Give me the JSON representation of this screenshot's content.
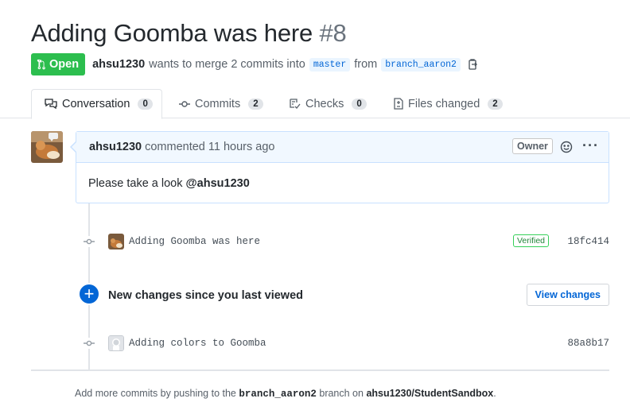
{
  "pr": {
    "title": "Adding Goomba was here",
    "number": "#8",
    "state": "Open",
    "author": "ahsu1230",
    "merge_text": "wants to merge 2 commits into",
    "base_branch": "master",
    "from_text": "from",
    "head_branch": "branch_aaron2"
  },
  "tabs": [
    {
      "label": "Conversation",
      "count": "0",
      "icon": "comment-discussion-icon"
    },
    {
      "label": "Commits",
      "count": "2",
      "icon": "git-commit-icon"
    },
    {
      "label": "Checks",
      "count": "0",
      "icon": "checklist-icon"
    },
    {
      "label": "Files changed",
      "count": "2",
      "icon": "file-diff-icon"
    }
  ],
  "comment": {
    "author": "ahsu1230",
    "action_text": "commented 11 hours ago",
    "badge": "Owner",
    "body_prefix": "Please take a look ",
    "mention": "@ahsu1230"
  },
  "commits": [
    {
      "message": "Adding Goomba was here",
      "verified": "Verified",
      "sha": "18fc414"
    },
    {
      "message": "Adding colors to Goomba",
      "verified": "",
      "sha": "88a8b17"
    }
  ],
  "new_changes": {
    "text": "New changes since you last viewed",
    "button": "View changes"
  },
  "footer": {
    "prefix": "Add more commits by pushing to the ",
    "branch": "branch_aaron2",
    "middle": " branch on ",
    "repo": "ahsu1230/StudentSandbox",
    "suffix": "."
  },
  "colors": {
    "open_green": "#2cbe4e",
    "link_blue": "#0366d6",
    "header_bg": "#f1f8ff",
    "header_border": "#c8e1ff"
  }
}
